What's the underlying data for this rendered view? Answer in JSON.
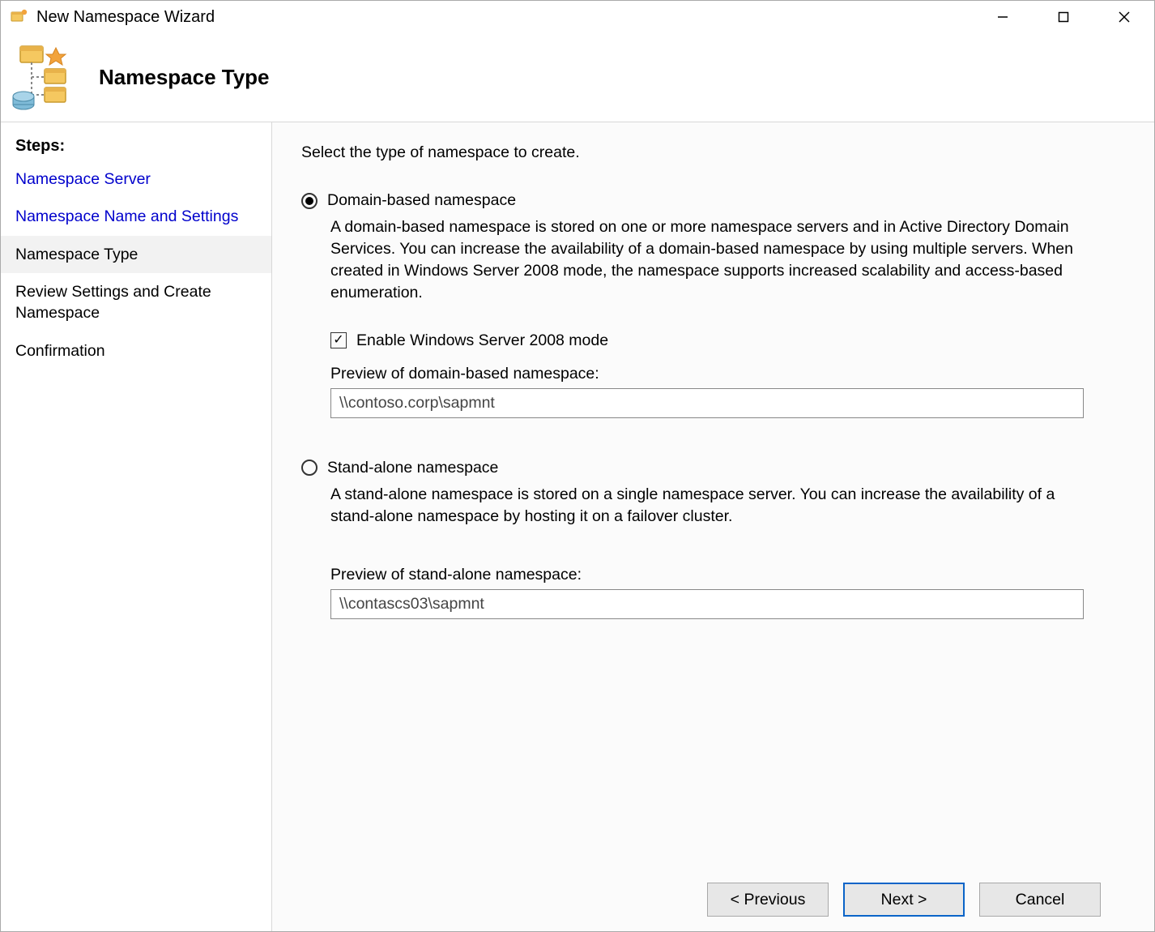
{
  "window": {
    "title": "New Namespace Wizard"
  },
  "header": {
    "title": "Namespace Type"
  },
  "sidebar": {
    "steps_label": "Steps:",
    "items": [
      {
        "label": "Namespace Server",
        "state": "done"
      },
      {
        "label": "Namespace Name and Settings",
        "state": "done"
      },
      {
        "label": "Namespace Type",
        "state": "current"
      },
      {
        "label": "Review Settings and Create Namespace",
        "state": "future"
      },
      {
        "label": "Confirmation",
        "state": "future"
      }
    ]
  },
  "main": {
    "instruction": "Select the type of namespace to create.",
    "option_domain": {
      "label": "Domain-based namespace",
      "selected": true,
      "description": "A domain-based namespace is stored on one or more namespace servers and in Active Directory Domain Services. You can increase the availability of a domain-based namespace by using multiple servers. When created in Windows Server 2008 mode, the namespace supports increased scalability and access-based enumeration.",
      "enable_2008_label": "Enable Windows Server 2008 mode",
      "enable_2008_checked": true,
      "preview_label": "Preview of domain-based namespace:",
      "preview_value": "\\\\contoso.corp\\sapmnt"
    },
    "option_standalone": {
      "label": "Stand-alone namespace",
      "selected": false,
      "description": "A stand-alone namespace is stored on a single namespace server. You can increase the availability of a stand-alone namespace by hosting it on a failover cluster.",
      "preview_label": "Preview of stand-alone namespace:",
      "preview_value": "\\\\contascs03\\sapmnt"
    }
  },
  "footer": {
    "previous": "< Previous",
    "next": "Next >",
    "cancel": "Cancel"
  }
}
